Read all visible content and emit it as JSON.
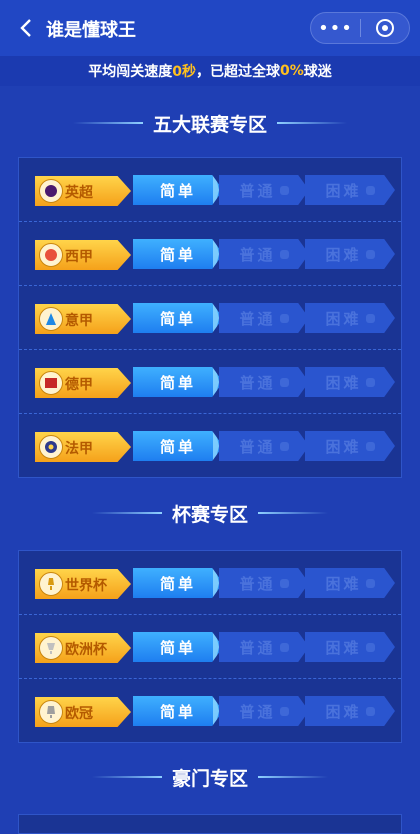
{
  "nav": {
    "title": "谁是懂球王",
    "more_icon": "more-dots-icon",
    "close_icon": "target-close-icon"
  },
  "banner": {
    "prefix": "平均闯关速度",
    "speed": "0秒",
    "mid": "，已超过全球",
    "percent": "0%",
    "suffix": "球迷"
  },
  "sections": {
    "five_leagues": {
      "title": "五大联赛专区",
      "rows": [
        {
          "name": "英超",
          "easy": "简单",
          "normal": "普通",
          "hard": "困难"
        },
        {
          "name": "西甲",
          "easy": "简单",
          "normal": "普通",
          "hard": "困难"
        },
        {
          "name": "意甲",
          "easy": "简单",
          "normal": "普通",
          "hard": "困难"
        },
        {
          "name": "德甲",
          "easy": "简单",
          "normal": "普通",
          "hard": "困难"
        },
        {
          "name": "法甲",
          "easy": "简单",
          "normal": "普通",
          "hard": "困难"
        }
      ]
    },
    "cups": {
      "title": "杯赛专区",
      "rows": [
        {
          "name": "世界杯",
          "easy": "简单",
          "normal": "普通",
          "hard": "困难"
        },
        {
          "name": "欧洲杯",
          "easy": "简单",
          "normal": "普通",
          "hard": "困难"
        },
        {
          "name": "欧冠",
          "easy": "简单",
          "normal": "普通",
          "hard": "困难"
        }
      ]
    },
    "clubs": {
      "title": "豪门专区"
    }
  },
  "colors": {
    "accent_gold": "#ffc01e",
    "easy_blue": "#1e7ef0",
    "locked_blue": "#2a55cf"
  }
}
